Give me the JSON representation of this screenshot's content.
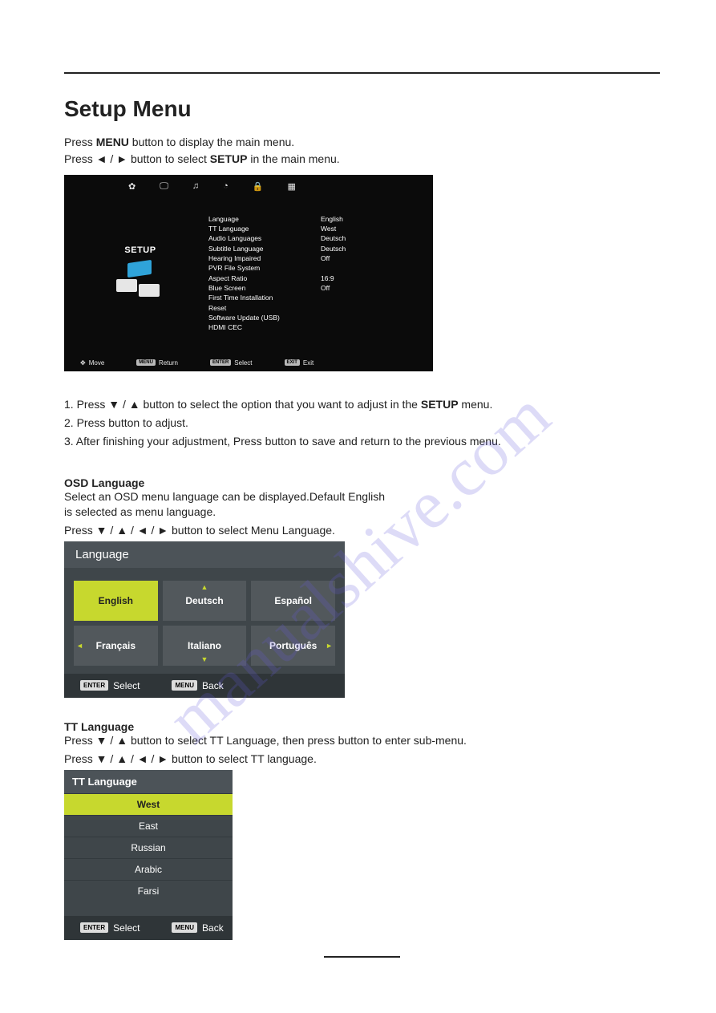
{
  "page": {
    "title": "Setup Menu",
    "intro1_pre": "Press ",
    "intro1_b": "MENU",
    "intro1_post": " button to display the main menu.",
    "intro2_pre": "Press ◄ / ► button to select ",
    "intro2_b": "SETUP",
    "intro2_post": " in the main menu."
  },
  "osd": {
    "side_label": "SETUP",
    "rows": [
      {
        "k": "Language",
        "v": "English"
      },
      {
        "k": "TT Language",
        "v": "West"
      },
      {
        "k": "Audio Languages",
        "v": "Deutsch"
      },
      {
        "k": "Subtitle Language",
        "v": "Deutsch"
      },
      {
        "k": "Hearing Impaired",
        "v": "Off"
      },
      {
        "k": "PVR File System",
        "v": ""
      },
      {
        "k": "Aspect Ratio",
        "v": "16:9"
      },
      {
        "k": "Blue Screen",
        "v": "Off"
      },
      {
        "k": "First Time Installation",
        "v": ""
      },
      {
        "k": "Reset",
        "v": ""
      },
      {
        "k": "Software Update (USB)",
        "v": ""
      },
      {
        "k": "HDMI CEC",
        "v": ""
      }
    ],
    "footer": {
      "move": "Move",
      "return_key": "MENU",
      "return": "Return",
      "select_key": "ENTER",
      "select": "Select",
      "exit_key": "EXIT",
      "exit": "Exit"
    }
  },
  "steps": {
    "s1_pre": "1. Press ▼ / ▲ button  to select the option that you want to adjust in the ",
    "s1_b": "SETUP",
    "s1_post": " menu.",
    "s2": "2. Press         button to adjust.",
    "s3": "3. After finishing your adjustment, Press          button to save and return to the previous menu."
  },
  "osd_lang": {
    "heading": "OSD Language",
    "desc": "Select an OSD menu language can be displayed.Default English\n is selected as menu language.",
    "instr": "Press ▼ / ▲ / ◄ / ► button to select Menu Language.",
    "title": "Language",
    "grid": [
      [
        "English",
        "Deutsch",
        "Español"
      ],
      [
        "Français",
        "Italiano",
        "Português"
      ]
    ],
    "footer": {
      "select_key": "ENTER",
      "select": "Select",
      "back_key": "MENU",
      "back": "Back"
    }
  },
  "tt_lang": {
    "heading": "TT Language",
    "l1": " Press ▼ / ▲ button to select TT Language,  then press          button to enter sub-menu.",
    "l2": " Press ▼ / ▲ / ◄ / ► button to select TT language.",
    "title": "TT Language",
    "items": [
      "West",
      "East",
      "Russian",
      "Arabic",
      "Farsi"
    ],
    "footer": {
      "select_key": "ENTER",
      "select": "Select",
      "back_key": "MENU",
      "back": "Back"
    }
  },
  "watermark": "manualshive.com"
}
